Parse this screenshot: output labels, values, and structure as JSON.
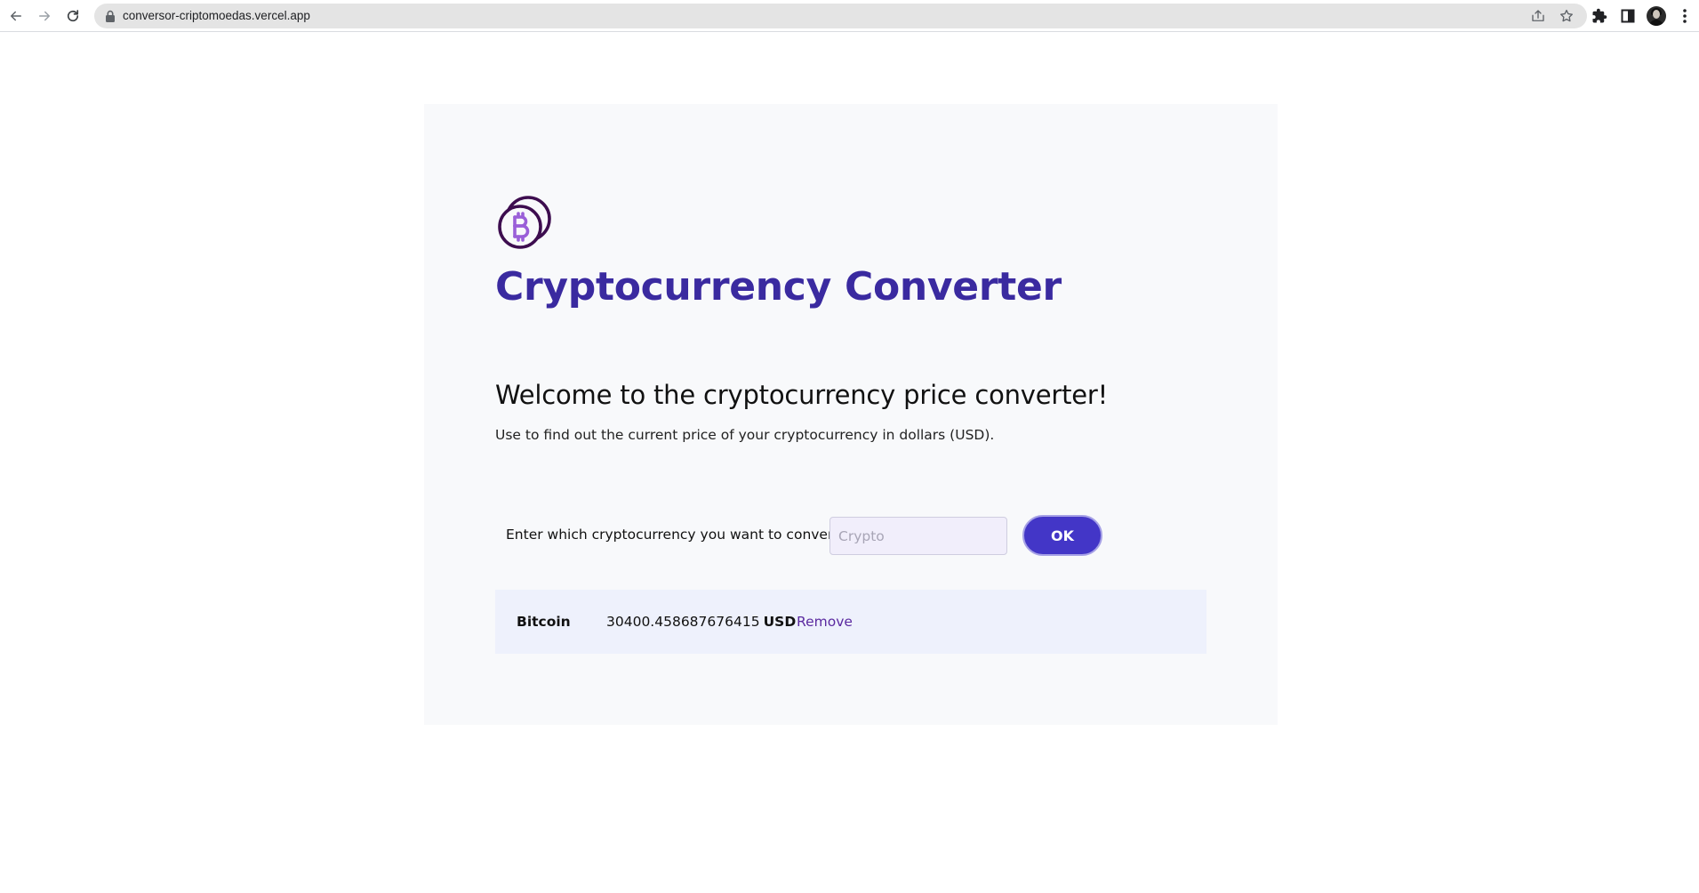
{
  "browser": {
    "url": "conversor-criptomoedas.vercel.app",
    "icons": {
      "back": "arrow-left-icon",
      "forward": "arrow-right-icon",
      "reload": "reload-icon",
      "lock": "lock-icon",
      "share": "share-icon",
      "bookmark": "star-icon",
      "extensions": "puzzle-icon",
      "side_panel": "side-panel-icon",
      "menu": "kebab-menu-icon"
    }
  },
  "app": {
    "title": "Cryptocurrency Converter",
    "logo": "bitcoin-coins-icon",
    "accent_color": "#3a2aa0"
  },
  "intro": {
    "heading": "Welcome to the cryptocurrency price converter!",
    "description": "Use to find out the current price of your cryptocurrency in dollars (USD)."
  },
  "form": {
    "label": "Enter which cryptocurrency you want to convert:",
    "input_value": "",
    "input_placeholder": "Crypto",
    "submit_label": "OK"
  },
  "results": [
    {
      "name": "Bitcoin",
      "price": "30400.458687676415",
      "currency": "USD",
      "remove_label": "Remove"
    }
  ]
}
